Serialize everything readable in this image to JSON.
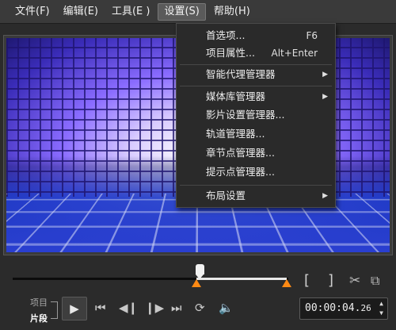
{
  "menubar": {
    "items": [
      {
        "label": "文件(F)"
      },
      {
        "label": "编辑(E)"
      },
      {
        "label": "工具(E )"
      },
      {
        "label": "设置(S)"
      },
      {
        "label": "帮助(H)"
      }
    ]
  },
  "settings_menu": {
    "items": [
      {
        "label": "首选项...",
        "shortcut": "F6"
      },
      {
        "label": "项目属性...",
        "shortcut": "Alt+Enter"
      },
      {
        "label": "智能代理管理器"
      },
      {
        "label": "媒体库管理器"
      },
      {
        "label": "影片设置管理器..."
      },
      {
        "label": "轨道管理器..."
      },
      {
        "label": "章节点管理器..."
      },
      {
        "label": "提示点管理器..."
      },
      {
        "label": "布局设置"
      }
    ]
  },
  "playback": {
    "mode_project": "项目",
    "mode_clip": "片段",
    "timecode": "00:00:04.",
    "timecode_frames": "26",
    "bracket_in": "[",
    "bracket_out": "]"
  },
  "icons": {
    "play": "play-icon",
    "home": "go-to-start-icon",
    "prev": "previous-frame-icon",
    "next": "next-frame-icon",
    "end": "go-to-end-icon",
    "repeat": "repeat-icon",
    "volume": "volume-icon",
    "cut": "scissors-icon",
    "copy": "copy-icon"
  },
  "colors": {
    "accent_orange": "#ff8a14",
    "menu_bg": "#2a2a2a"
  }
}
